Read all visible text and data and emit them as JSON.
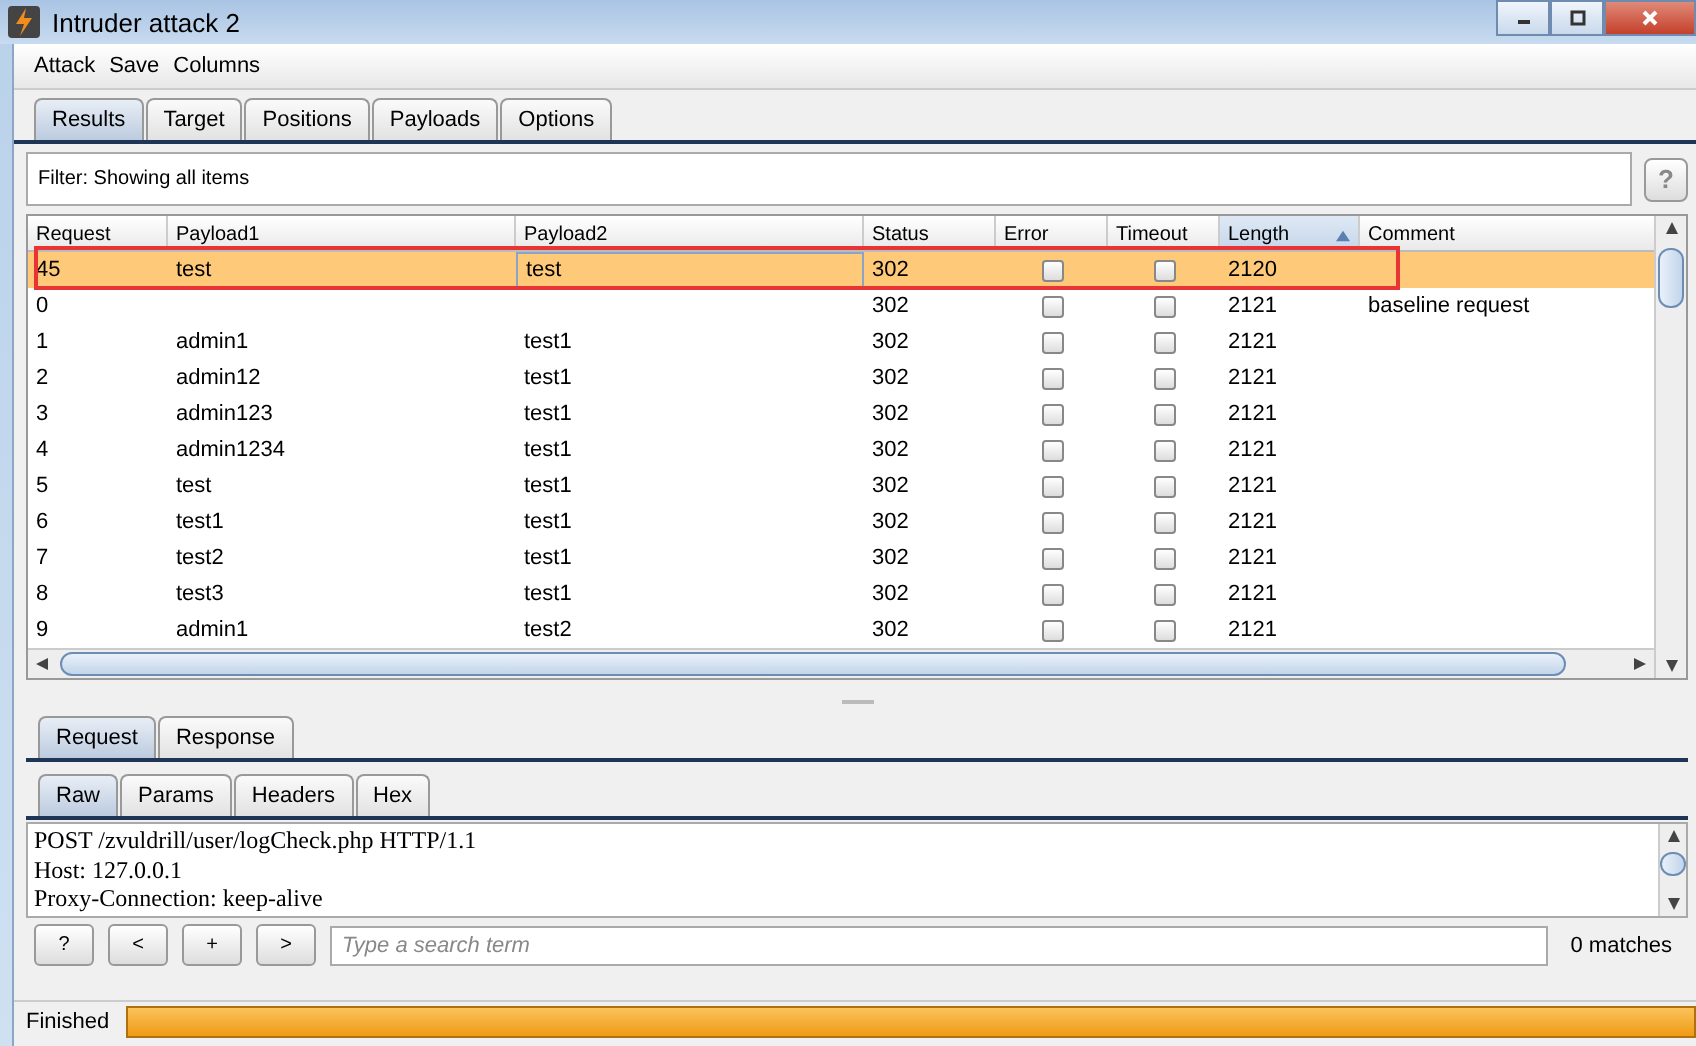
{
  "window": {
    "title": "Intruder attack 2"
  },
  "menu": [
    "Attack",
    "Save",
    "Columns"
  ],
  "tabs": [
    {
      "label": "Results",
      "selected": true
    },
    {
      "label": "Target",
      "selected": false
    },
    {
      "label": "Positions",
      "selected": false
    },
    {
      "label": "Payloads",
      "selected": false
    },
    {
      "label": "Options",
      "selected": false
    }
  ],
  "filter": {
    "text": "Filter:  Showing all items",
    "help": "?"
  },
  "table": {
    "columns": [
      {
        "label": "Request",
        "sorted": false
      },
      {
        "label": "Payload1",
        "sorted": false
      },
      {
        "label": "Payload2",
        "sorted": false
      },
      {
        "label": "Status",
        "sorted": false
      },
      {
        "label": "Error",
        "sorted": false
      },
      {
        "label": "Timeout",
        "sorted": false
      },
      {
        "label": "Length",
        "sorted": true
      },
      {
        "label": "Comment",
        "sorted": false
      }
    ],
    "rows": [
      {
        "request": "45",
        "payload1": "test",
        "payload2": "test",
        "status": "302",
        "error": false,
        "timeout": false,
        "length": "2120",
        "comment": "",
        "selected": true,
        "highlighted": true
      },
      {
        "request": "0",
        "payload1": "",
        "payload2": "",
        "status": "302",
        "error": false,
        "timeout": false,
        "length": "2121",
        "comment": "baseline request",
        "selected": false,
        "highlighted": false
      },
      {
        "request": "1",
        "payload1": "admin1",
        "payload2": "test1",
        "status": "302",
        "error": false,
        "timeout": false,
        "length": "2121",
        "comment": "",
        "selected": false,
        "highlighted": false
      },
      {
        "request": "2",
        "payload1": "admin12",
        "payload2": "test1",
        "status": "302",
        "error": false,
        "timeout": false,
        "length": "2121",
        "comment": "",
        "selected": false,
        "highlighted": false
      },
      {
        "request": "3",
        "payload1": "admin123",
        "payload2": "test1",
        "status": "302",
        "error": false,
        "timeout": false,
        "length": "2121",
        "comment": "",
        "selected": false,
        "highlighted": false
      },
      {
        "request": "4",
        "payload1": "admin1234",
        "payload2": "test1",
        "status": "302",
        "error": false,
        "timeout": false,
        "length": "2121",
        "comment": "",
        "selected": false,
        "highlighted": false
      },
      {
        "request": "5",
        "payload1": "test",
        "payload2": "test1",
        "status": "302",
        "error": false,
        "timeout": false,
        "length": "2121",
        "comment": "",
        "selected": false,
        "highlighted": false
      },
      {
        "request": "6",
        "payload1": "test1",
        "payload2": "test1",
        "status": "302",
        "error": false,
        "timeout": false,
        "length": "2121",
        "comment": "",
        "selected": false,
        "highlighted": false
      },
      {
        "request": "7",
        "payload1": "test2",
        "payload2": "test1",
        "status": "302",
        "error": false,
        "timeout": false,
        "length": "2121",
        "comment": "",
        "selected": false,
        "highlighted": false
      },
      {
        "request": "8",
        "payload1": "test3",
        "payload2": "test1",
        "status": "302",
        "error": false,
        "timeout": false,
        "length": "2121",
        "comment": "",
        "selected": false,
        "highlighted": false
      },
      {
        "request": "9",
        "payload1": "admin1",
        "payload2": "test2",
        "status": "302",
        "error": false,
        "timeout": false,
        "length": "2121",
        "comment": "",
        "selected": false,
        "highlighted": false
      }
    ]
  },
  "message_tabs": [
    {
      "label": "Request",
      "selected": true
    },
    {
      "label": "Response",
      "selected": false
    }
  ],
  "view_tabs": [
    {
      "label": "Raw",
      "selected": true
    },
    {
      "label": "Params",
      "selected": false
    },
    {
      "label": "Headers",
      "selected": false
    },
    {
      "label": "Hex",
      "selected": false
    }
  ],
  "request_lines": [
    "POST /zvuldrill/user/logCheck.php HTTP/1.1",
    "Host: 127.0.0.1",
    "Proxy-Connection: keep-alive"
  ],
  "search": {
    "buttons": [
      "?",
      "<",
      "+",
      ">"
    ],
    "placeholder": "Type a search term",
    "matches": "0 matches"
  },
  "status_bar": {
    "text": "Finished",
    "level": 1
  }
}
